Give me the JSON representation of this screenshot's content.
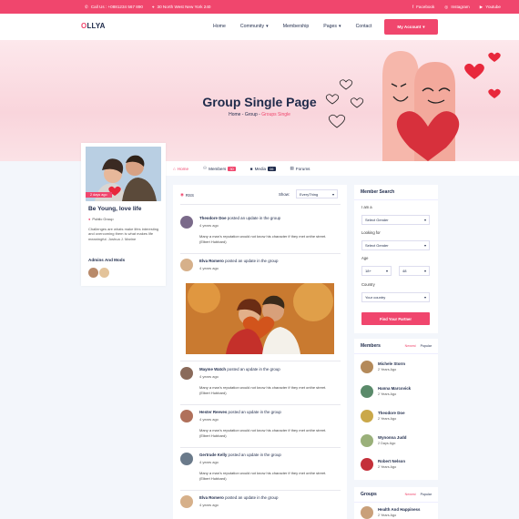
{
  "topbar": {
    "phone": "Call Us : +0881234 567 890",
    "address": "30 North West New York 240",
    "social": [
      "Facebook",
      "Instagram",
      "Youtube"
    ]
  },
  "header": {
    "logo_o": "O",
    "logo_rest": "LLYA",
    "nav": [
      "Home",
      "Community",
      "Membership",
      "Pages",
      "Contact"
    ],
    "account_label": "My Account"
  },
  "hero": {
    "title": "Group Single Page",
    "crumb_home": "Home",
    "crumb_group": "Group",
    "crumb_current": "Groups Single"
  },
  "tabs": {
    "home": "Home",
    "members": "Members",
    "members_count": "30",
    "media": "Media",
    "media_count": "06",
    "forums": "Forums"
  },
  "group": {
    "tag": "2 days ago",
    "name": "Be Young, love life",
    "type": "Public Group",
    "description": "Challenges are whats make lifes interesting and overcoming them is what makes life meaningful. Joshua J. Marine",
    "admins_label": "Admins And Mods"
  },
  "feed": {
    "rss": "RSS",
    "show_label": "Show:",
    "show_value": "EveryThing",
    "posts": [
      {
        "name": "Theodore Doe",
        "action": "posted an update in the group",
        "time": "4 years ago",
        "text": "Many a man's reputation would not know his character if they met onthe street. (Elbert Hubbard)"
      },
      {
        "name": "Elva Romero",
        "action": "posted an update in the group",
        "time": "4 years ago"
      },
      {
        "name": "Mayme Watch",
        "action": "posted an update in the group",
        "time": "4 years ago",
        "text": "Many a man's reputation would not know his character if they met onthe street. (Elbert Hubbard)"
      },
      {
        "name": "Hester Reeves",
        "action": "posted an update in the group",
        "time": "4 years ago",
        "text": "Many a man's reputation would not know his character if they met onthe street. (Elbert Hubbard)"
      },
      {
        "name": "Gertrude Kelly",
        "action": "posted an update in the group",
        "time": "4 years ago",
        "text": "Many a man's reputation would not know his character if they met onthe street. (Elbert Hubbard)"
      },
      {
        "name": "Elva Romero",
        "action": "posted an update in the group",
        "time": "4 years ago"
      }
    ]
  },
  "search": {
    "title": "Member Search",
    "i_am": "I am a",
    "i_am_value": "Select Gender",
    "looking": "Looking for",
    "looking_value": "Select Gender",
    "age": "Age",
    "age_from": "18+",
    "age_to": "48",
    "country": "Country",
    "country_value": "Your country",
    "button": "Find Your Partner"
  },
  "members": {
    "title": "Members",
    "tab_newest": "Newest",
    "tab_popular": "Popular",
    "list": [
      {
        "name": "Michele Storm",
        "time": "2 Years Ago"
      },
      {
        "name": "Hanna Marcovick",
        "time": "2 Years Ago"
      },
      {
        "name": "Theodore Doe",
        "time": "2 Years Ago"
      },
      {
        "name": "Wynonna Judd",
        "time": "2 Days Ago"
      },
      {
        "name": "Robert Nelson",
        "time": "2 Years Ago"
      }
    ]
  },
  "groups": {
    "title": "Groups",
    "tab_newest": "Newest",
    "tab_popular": "Popular",
    "list": [
      {
        "name": "Health And Happiness",
        "time": "2 Years Ago"
      }
    ]
  },
  "colors": {
    "accent": "#f0466d",
    "navy": "#1e2a4a",
    "bg": "#f3f6fb"
  }
}
